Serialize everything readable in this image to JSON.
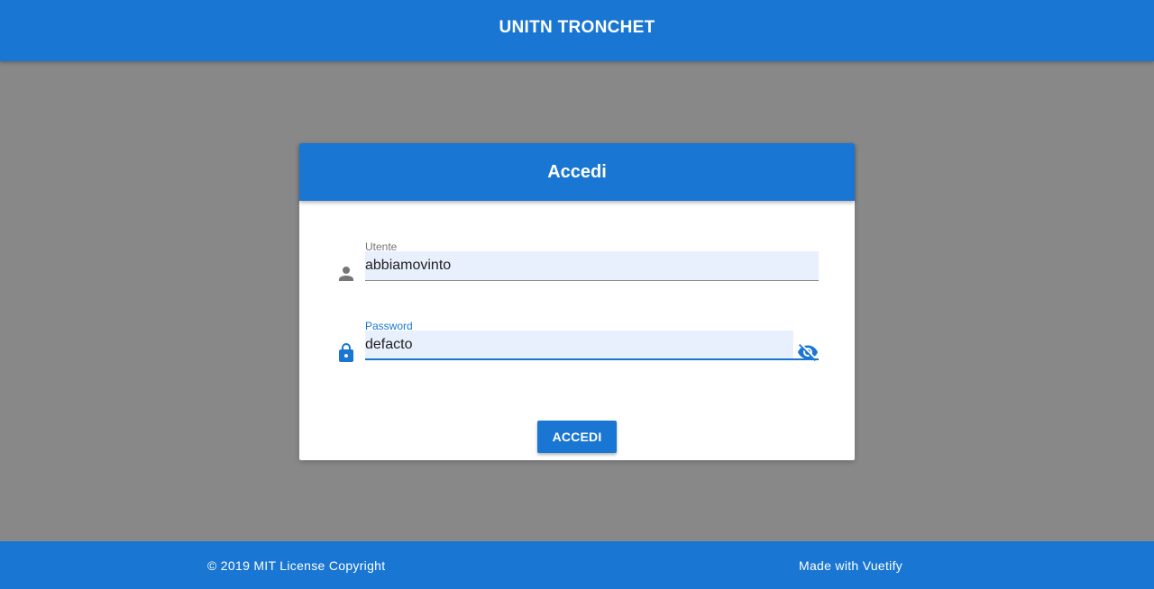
{
  "app": {
    "title": "UNITN TRONCHET"
  },
  "login_card": {
    "title": "Accedi",
    "user_field": {
      "label": "Utente",
      "value": "abbiamovinto",
      "icon": "person-icon"
    },
    "password_field": {
      "label": "Password",
      "value": "defacto",
      "icon": "lock-icon",
      "toggle_icon": "eye-off-icon"
    },
    "submit_label": "ACCEDI"
  },
  "footer": {
    "copyright": "© 2019 MIT License Copyright",
    "made_with": "Made with Vuetify"
  },
  "colors": {
    "primary": "#1976d2",
    "background": "#888888",
    "input_fill": "#e8f0fe",
    "icon_gray": "#757575"
  }
}
